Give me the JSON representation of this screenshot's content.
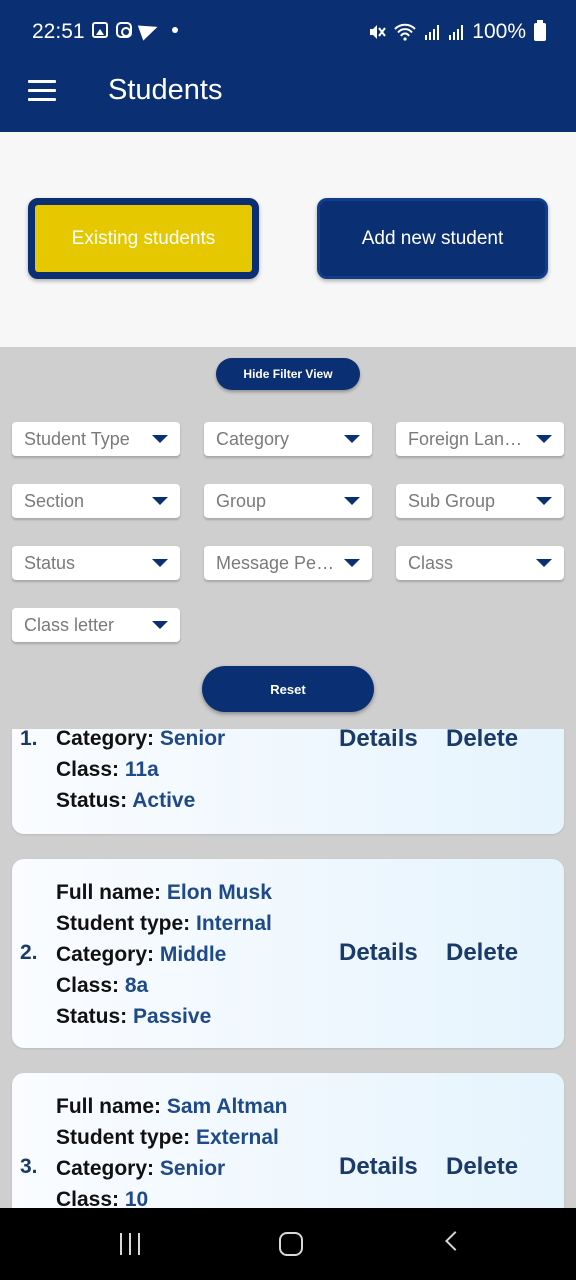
{
  "status_bar": {
    "time": "22:51",
    "battery": "100%"
  },
  "app_bar": {
    "title": "Students"
  },
  "top_buttons": {
    "existing": "Existing students",
    "add_new": "Add new student"
  },
  "filters": {
    "hide_label": "Hide Filter View",
    "dropdowns": [
      "Student Type",
      "Category",
      "Foreign Langua...",
      "Section",
      "Group",
      "Sub Group",
      "Status",
      "Message Perm...",
      "Class",
      "Class letter"
    ],
    "reset_label": "Reset"
  },
  "field_labels": {
    "full_name": "Full name: ",
    "student_type": "Student type: ",
    "category": "Category: ",
    "class": "Class: ",
    "status": "Status: "
  },
  "actions": {
    "details": "Details",
    "delete": "Delete"
  },
  "students": [
    {
      "num": "1.",
      "category": "Senior",
      "class": "11a",
      "status": "Active"
    },
    {
      "num": "2.",
      "full_name": "Elon Musk",
      "student_type": "Internal",
      "category": "Middle",
      "class": "8a",
      "status": "Passive"
    },
    {
      "num": "3.",
      "full_name": "Sam Altman",
      "student_type": "External",
      "category": "Senior",
      "class": "10"
    }
  ],
  "colors": {
    "primary": "#0b2f73",
    "accent": "#e6c800",
    "background": "#cfcfcf"
  }
}
